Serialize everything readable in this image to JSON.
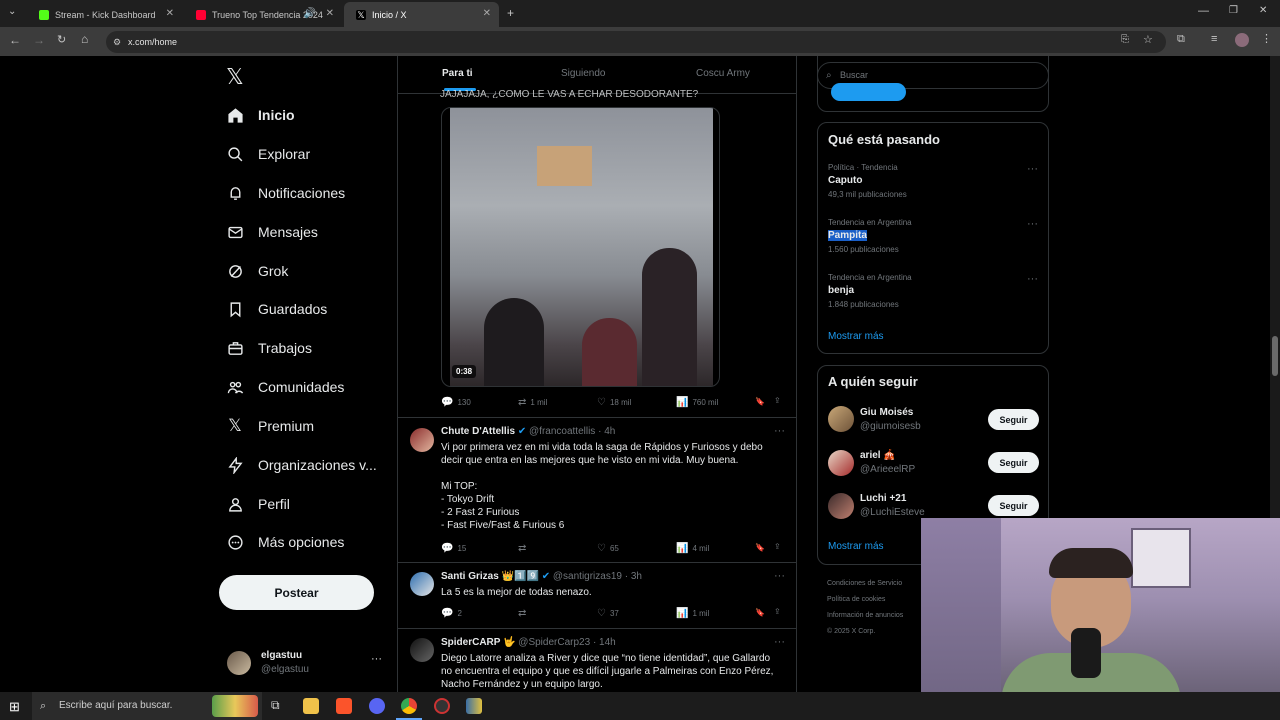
{
  "browser": {
    "tabs": [
      {
        "title": "Stream - Kick Dashboard",
        "color": "#53fc18"
      },
      {
        "title": "Trueno Top Tendencia 2024",
        "color": "#ff0033"
      },
      {
        "title": "Inicio / X",
        "color": "#ffffff"
      }
    ],
    "url": "x.com/home"
  },
  "sidebar": {
    "items": [
      {
        "label": "Inicio",
        "icon": "home-icon"
      },
      {
        "label": "Explorar",
        "icon": "search-icon"
      },
      {
        "label": "Notificaciones",
        "icon": "bell-icon"
      },
      {
        "label": "Mensajes",
        "icon": "mail-icon"
      },
      {
        "label": "Grok",
        "icon": "grok-icon"
      },
      {
        "label": "Guardados",
        "icon": "bookmark-icon"
      },
      {
        "label": "Trabajos",
        "icon": "briefcase-icon"
      },
      {
        "label": "Comunidades",
        "icon": "people-icon"
      },
      {
        "label": "Premium",
        "icon": "x-logo-icon"
      },
      {
        "label": "Organizaciones v...",
        "icon": "lightning-icon"
      },
      {
        "label": "Perfil",
        "icon": "person-icon"
      },
      {
        "label": "Más opciones",
        "icon": "more-circle-icon"
      }
    ],
    "post_label": "Postear",
    "account": {
      "name": "elgastuu",
      "handle": "@elgastuu"
    }
  },
  "feed": {
    "tabs": [
      "Para ti",
      "Siguiendo",
      "Coscu Army"
    ],
    "top_text": "JAJAJAJA, ¿COMO LE VAS A ECHAR DESODORANTE?",
    "video_duration": "0:38",
    "video_stats": {
      "replies": "130",
      "reposts": "1 mil",
      "likes": "18 mil",
      "views": "760 mil"
    },
    "tweets": [
      {
        "name": "Chute D'Attellis",
        "handle": "@francoattellis",
        "time": "· 4h",
        "text": "Vi por primera vez en mi vida toda la saga de Rápidos y Furiosos y debo decir que entra en las mejores que he visto en mi vida. Muy buena.\n\nMi TOP:\n- Tokyo Drift\n- 2 Fast 2 Furious\n- Fast Five/Fast & Furious 6",
        "replies": "15",
        "reposts": "",
        "likes": "65",
        "views": "4 mil"
      },
      {
        "name": "Santi Grizas 👑1️⃣9️⃣",
        "handle": "@santigrizas19",
        "time": "· 3h",
        "text": "La 5 es la mejor de todas nenazo.",
        "replies": "2",
        "reposts": "",
        "likes": "37",
        "views": "1 mil"
      },
      {
        "name": "SpiderCARP 🤟",
        "handle": "@SpiderCarp23",
        "time": "· 14h",
        "text": "Diego Latorre analiza a River y dice que “no tiene identidad”, que Gallardo no encuentra el equipo y que es difícil jugarle a Palmeiras con Enzo Pérez, Nacho Fernández y un equipo largo."
      }
    ]
  },
  "right": {
    "search_placeholder": "Buscar",
    "trends_title": "Qué está pasando",
    "trends": [
      {
        "meta": "Política · Tendencia",
        "name": "Caputo",
        "count": "49,3 mil publicaciones"
      },
      {
        "meta": "Tendencia en Argentina",
        "name": "Pampita",
        "count": "1.560 publicaciones"
      },
      {
        "meta": "Tendencia en Argentina",
        "name": "benja",
        "count": "1.848 publicaciones"
      }
    ],
    "show_more": "Mostrar más",
    "follow_title": "A quién seguir",
    "follow": [
      {
        "name": "Giu Moisés",
        "handle": "@giumoisesb"
      },
      {
        "name": "ariel 🎪",
        "handle": "@ArieeelRP"
      },
      {
        "name": "Luchi +21",
        "handle": "@LuchiEsteve"
      }
    ],
    "follow_label": "Seguir",
    "footer": [
      "Condiciones de Servicio",
      "Política de cookies",
      "Información de anuncios",
      "© 2025 X Corp."
    ]
  },
  "taskbar": {
    "search_placeholder": "Escribe aquí para buscar."
  }
}
